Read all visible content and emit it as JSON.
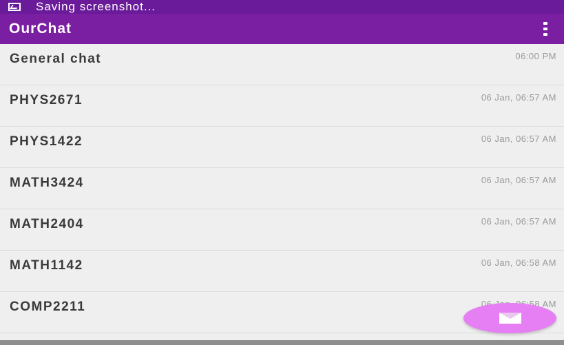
{
  "status_bar": {
    "text": "Saving screenshot...",
    "icon": "screenshot-icon"
  },
  "app_bar": {
    "title": "OurChat",
    "menu_icon": "overflow-menu-icon"
  },
  "chats": [
    {
      "name": "General chat",
      "time": "06:00 PM"
    },
    {
      "name": "PHYS2671",
      "time": "06 Jan, 06:57 AM"
    },
    {
      "name": "PHYS1422",
      "time": "06 Jan, 06:57 AM"
    },
    {
      "name": "MATH3424",
      "time": "06 Jan, 06:57 AM"
    },
    {
      "name": "MATH2404",
      "time": "06 Jan, 06:57 AM"
    },
    {
      "name": "MATH1142",
      "time": "06 Jan, 06:58 AM"
    },
    {
      "name": "COMP2211",
      "time": "06 Jan, 06:58 AM"
    }
  ],
  "fab": {
    "icon": "mail-icon"
  },
  "colors": {
    "status_bar": "#6a1b9a",
    "app_bar": "#7b1fa2",
    "fab": "#e57ff3",
    "background": "#efefef"
  }
}
